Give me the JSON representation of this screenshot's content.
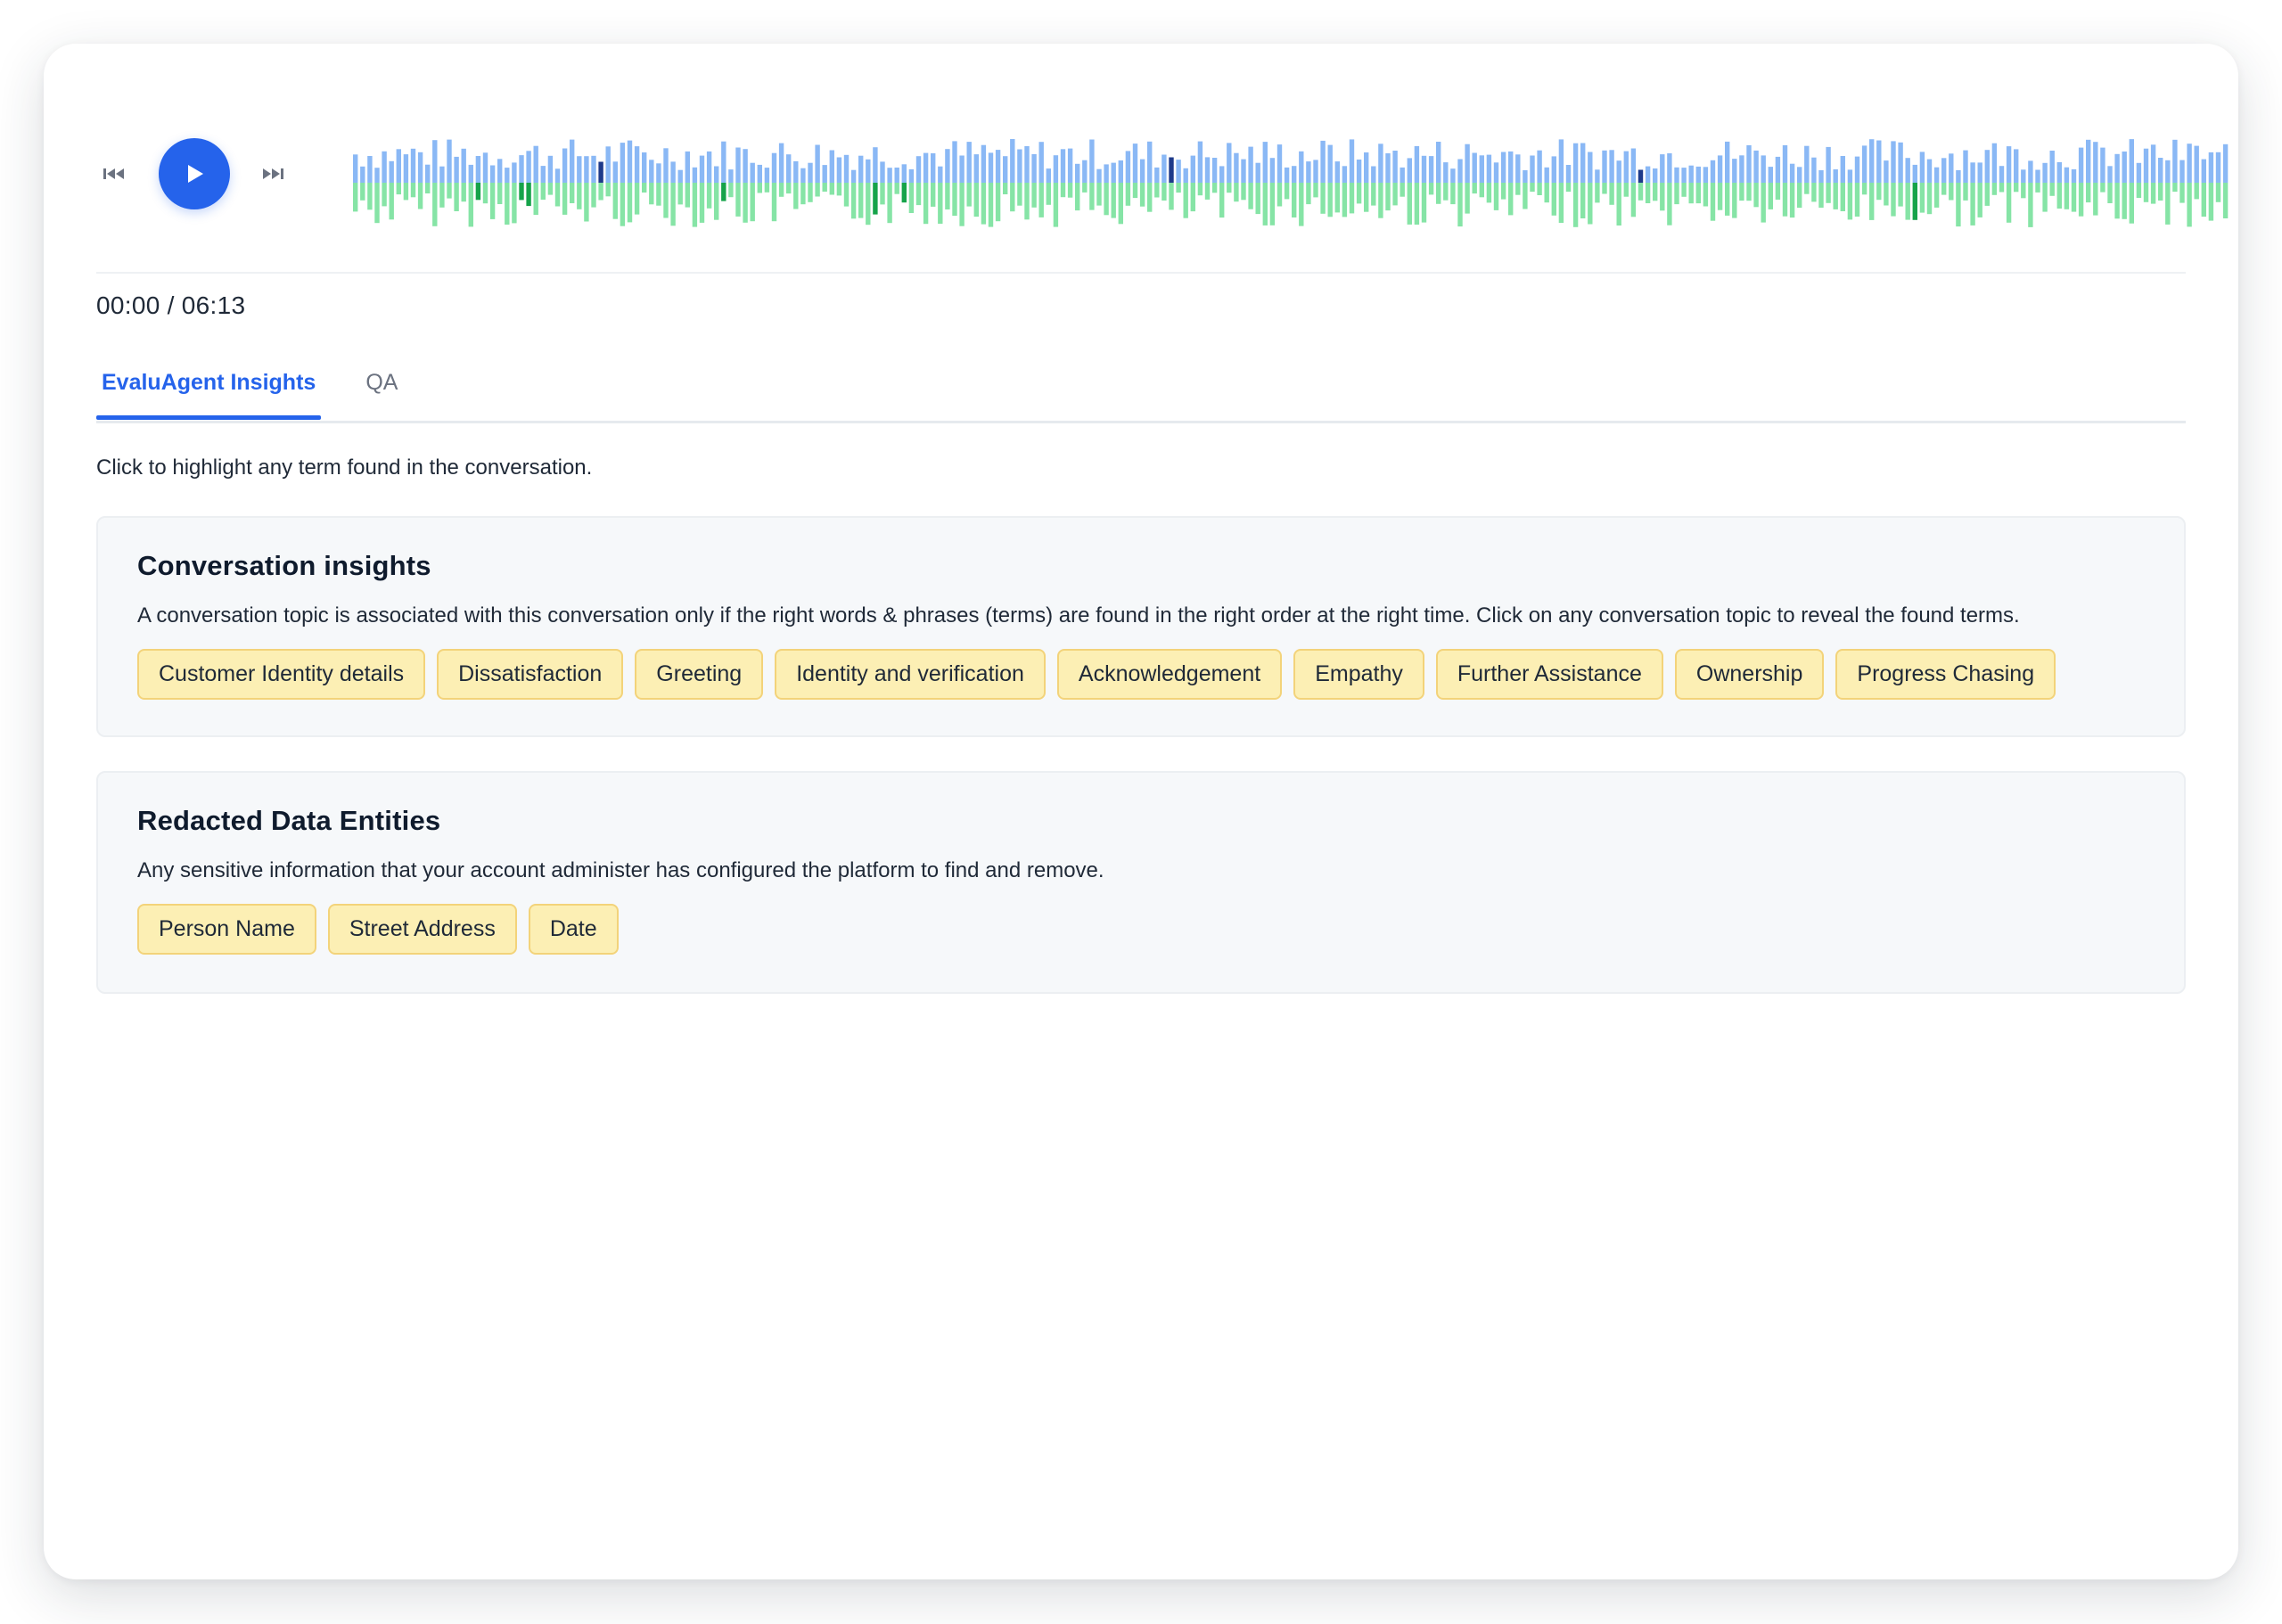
{
  "player": {
    "prev_icon": "skip-back-icon",
    "play_icon": "play-icon",
    "next_icon": "skip-forward-icon",
    "current_time": "00:00",
    "total_time": "06:13",
    "time_display": "00:00 / 06:13",
    "colors": {
      "accent": "#2563eb",
      "wave_top": "#8ab8f5",
      "wave_top_marker": "#1e3a8a",
      "wave_bottom": "#86e4a6",
      "wave_bottom_marker": "#16a34a"
    }
  },
  "tabs": [
    {
      "label": "EvaluAgent Insights",
      "active": true
    },
    {
      "label": "QA",
      "active": false
    }
  ],
  "hint": "Click to highlight any term found in the conversation.",
  "insights": {
    "title": "Conversation insights",
    "description": "A conversation topic is associated with this conversation only if the right words & phrases (terms) are found in the right order at the right time. Click on any conversation topic to reveal the found terms.",
    "topics": [
      "Customer Identity details",
      "Dissatisfaction",
      "Greeting",
      "Identity and verification",
      "Acknowledgement",
      "Empathy",
      "Further Assistance",
      "Ownership",
      "Progress Chasing"
    ]
  },
  "redacted": {
    "title": "Redacted Data Entities",
    "description": "Any sensitive information that your account administer has configured the platform to find and remove.",
    "entities": [
      "Person Name",
      "Street Address",
      "Date"
    ]
  },
  "chip_colors": {
    "fill": "#fcefb4",
    "border": "#f3d37a"
  }
}
